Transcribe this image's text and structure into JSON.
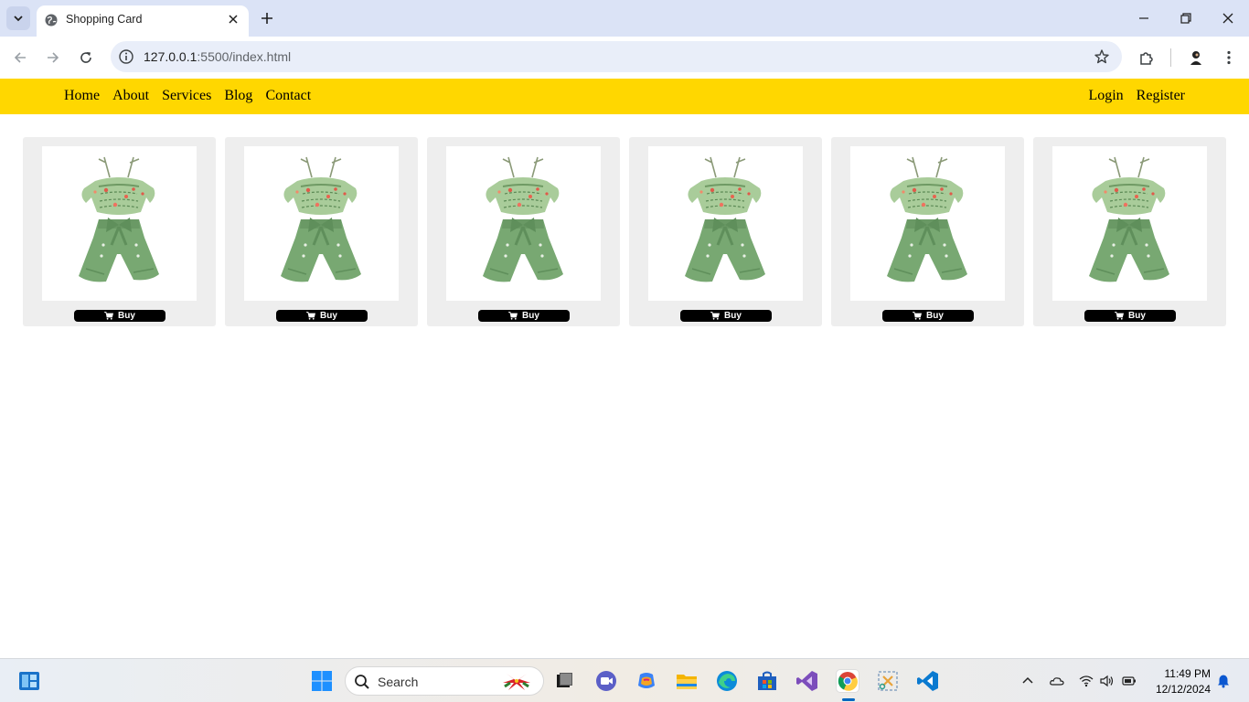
{
  "browser": {
    "tab_title": "Shopping Card",
    "url_host": "127.0.0.1",
    "url_rest": ":5500/index.html"
  },
  "nav": {
    "left_links": [
      "Home",
      "About",
      "Services",
      "Blog",
      "Contact"
    ],
    "right_links": [
      "Login",
      "Register"
    ]
  },
  "products": [
    {
      "buy_label": "Buy"
    },
    {
      "buy_label": "Buy"
    },
    {
      "buy_label": "Buy"
    },
    {
      "buy_label": "Buy"
    },
    {
      "buy_label": "Buy"
    },
    {
      "buy_label": "Buy"
    }
  ],
  "taskbar": {
    "search_placeholder": "Search",
    "time": "11:49 PM",
    "date": "12/12/2024"
  },
  "colors": {
    "navbar": "#ffd700",
    "card_bg": "#eeeeee",
    "buy_button": "#000000",
    "tabbar": "#dbe3f6"
  }
}
